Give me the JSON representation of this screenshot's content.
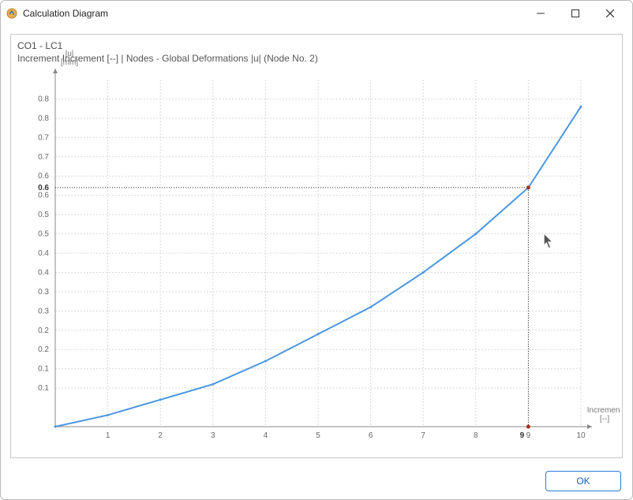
{
  "window": {
    "title": "Calculation Diagram",
    "min_tip": "Minimize",
    "max_tip": "Maximize",
    "close_tip": "Close"
  },
  "header": {
    "line1": "CO1 - LC1",
    "line2": "Increment Increment [--] | Nodes - Global Deformations |u| (Node No. 2)"
  },
  "footer": {
    "ok_label": "OK"
  },
  "chart_data": {
    "type": "line",
    "xlabel": "Increment\n[--]",
    "ylabel": "|u|\n[mm]",
    "x": [
      0,
      1,
      2,
      3,
      4,
      5,
      6,
      7,
      8,
      9,
      10
    ],
    "values": [
      0.0,
      0.03,
      0.07,
      0.11,
      0.17,
      0.24,
      0.31,
      0.4,
      0.5,
      0.62,
      0.83
    ],
    "xlim": [
      0,
      10
    ],
    "ylim": [
      0,
      0.9
    ],
    "xticks": [
      1,
      2,
      3,
      4,
      5,
      6,
      7,
      8,
      9,
      10
    ],
    "yticks": [
      0.1,
      0.1,
      0.2,
      0.2,
      0.3,
      0.3,
      0.4,
      0.4,
      0.5,
      0.5,
      0.6,
      0.6,
      0.7,
      0.7,
      0.8,
      0.8
    ],
    "ygrid": [
      0.1,
      0.15,
      0.2,
      0.25,
      0.3,
      0.35,
      0.4,
      0.45,
      0.5,
      0.55,
      0.6,
      0.65,
      0.7,
      0.75,
      0.8,
      0.85
    ],
    "marker": {
      "x": 9,
      "y": 0.62,
      "xlabel": "9",
      "ylabel": "0.6"
    },
    "cursor": {
      "x": 9.3,
      "y": 0.5
    }
  }
}
